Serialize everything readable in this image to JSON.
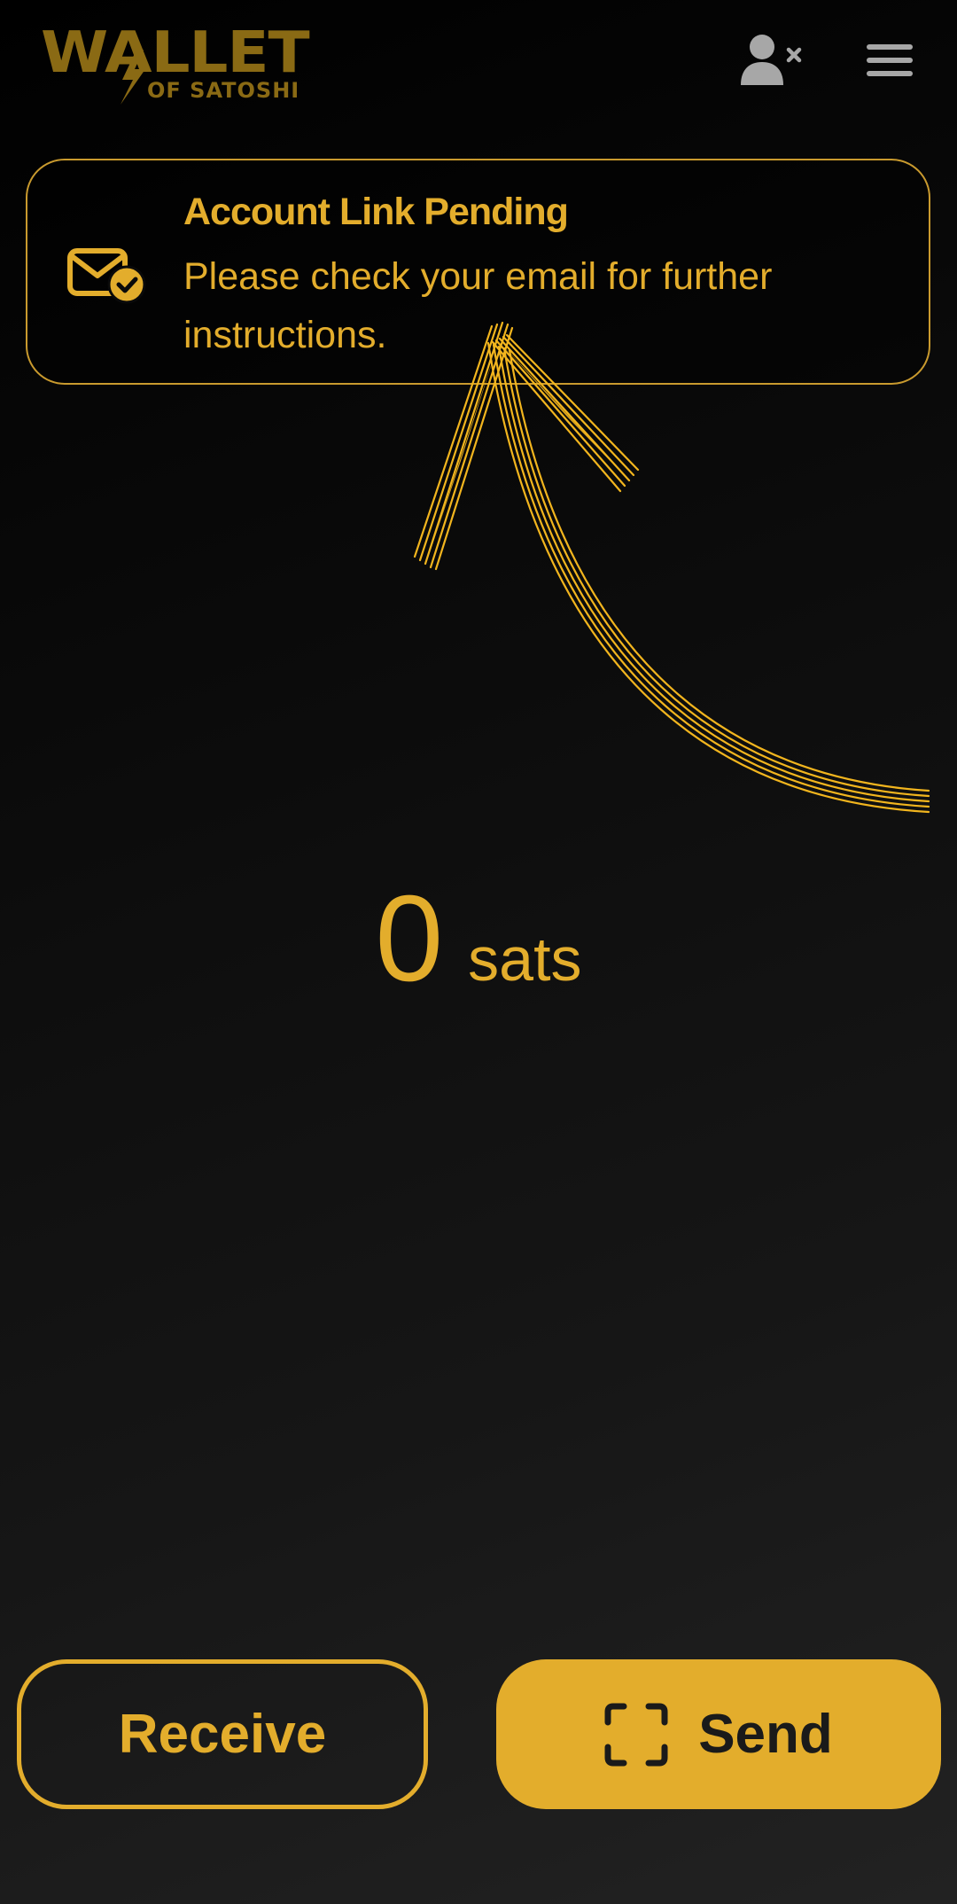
{
  "header": {
    "logo": {
      "word": "WALLET",
      "sub": "OF SATOSHI"
    },
    "account_icon": "user-unlinked-icon",
    "menu_icon": "hamburger-menu-icon"
  },
  "banner": {
    "title": "Account Link Pending",
    "message": "Please check your email for further instructions.",
    "icon": "envelope-check-icon"
  },
  "balance": {
    "amount": "0",
    "unit": "sats"
  },
  "actions": {
    "receive_label": "Receive",
    "send_label": "Send",
    "send_icon": "scan-frame-icon"
  },
  "colors": {
    "accent": "#E3AD2C",
    "logo": "#8A6A14",
    "icon_gray": "#A7A7A7",
    "background": "#0b0b0b"
  }
}
